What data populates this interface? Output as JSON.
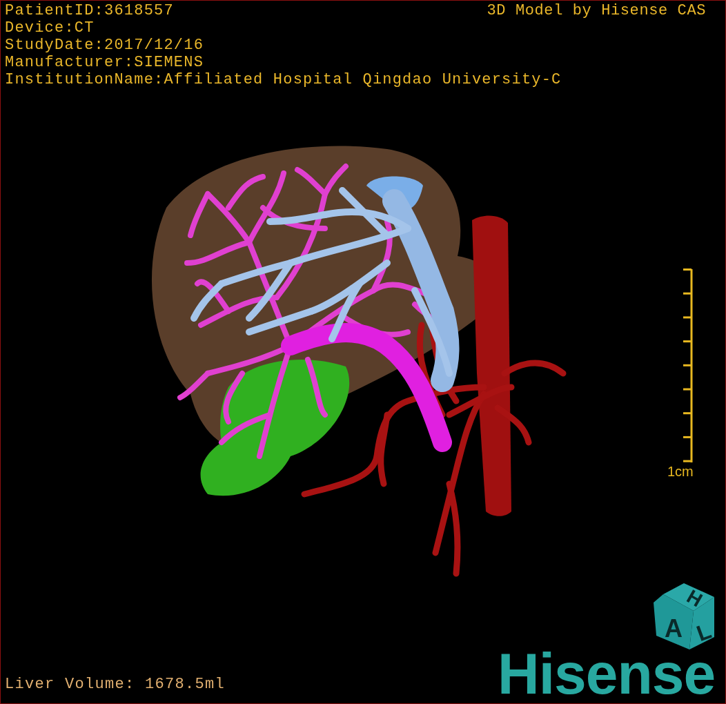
{
  "info_lines": [
    "PatientID:3618557",
    "Device:CT",
    "StudyDate:2017/12/16",
    "Manufacturer:SIEMENS",
    "InstitutionName:Affiliated Hospital Qingdao University-C"
  ],
  "credit": "3D Model by Hisense CAS",
  "scale_bar": {
    "label": "1cm"
  },
  "orientation_cube": {
    "faces": [
      "H",
      "A",
      "L"
    ]
  },
  "liver_volume": "Liver Volume: 1678.5ml",
  "logo": "Hisense"
}
